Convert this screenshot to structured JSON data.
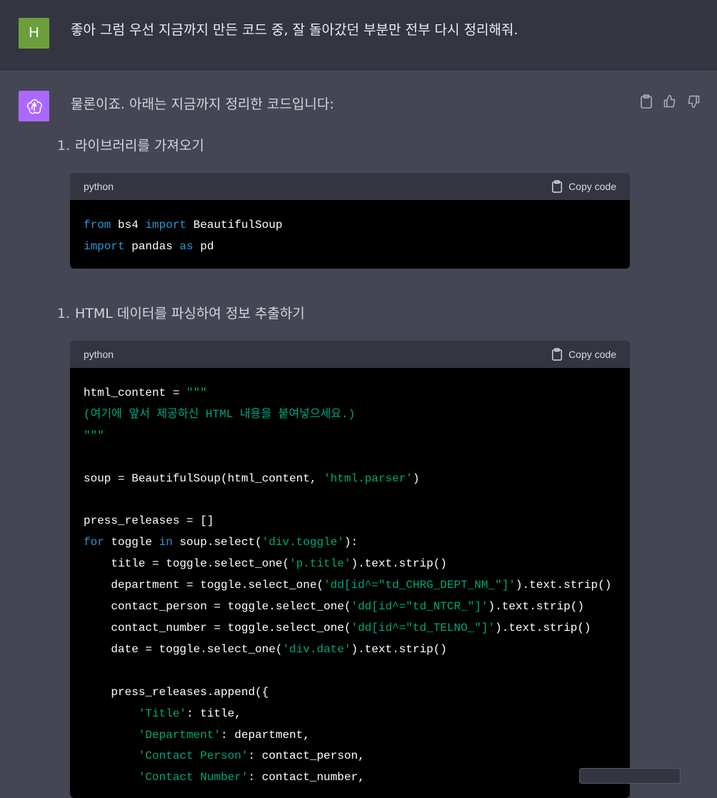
{
  "user": {
    "avatar_letter": "H",
    "message": "좋아 그럼 우선 지금까지 만든 코드 중, 잘 돌아갔던 부분만 전부 다시 정리해줘."
  },
  "assistant": {
    "intro": "물론이죠. 아래는 지금까지 정리한 코드입니다:",
    "actions": [
      "clipboard-icon",
      "thumbs-up-icon",
      "thumbs-down-icon"
    ],
    "sections": [
      {
        "number": "1.",
        "title": "라이브러리를 가져오기"
      },
      {
        "number": "1.",
        "title": "HTML 데이터를 파싱하여 정보 추출하기"
      }
    ],
    "code_blocks": [
      {
        "language": "python",
        "copy_label": "Copy code"
      },
      {
        "language": "python",
        "copy_label": "Copy code"
      }
    ]
  },
  "colors": {
    "keyword": "#2e95d3",
    "string": "#00a67d",
    "user_avatar": "#6a9f3c",
    "bot_avatar": "#ab68ff"
  }
}
